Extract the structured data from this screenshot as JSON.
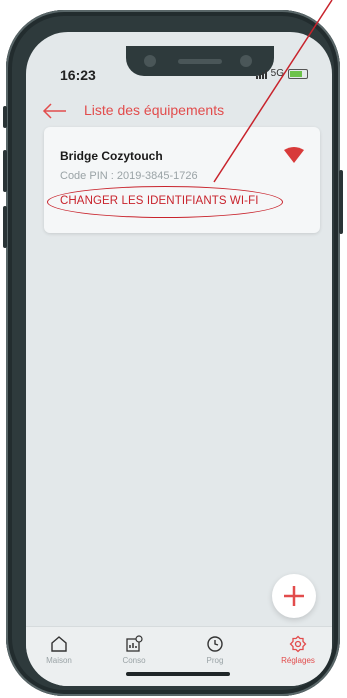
{
  "status_bar": {
    "time": "16:23",
    "network": "5G"
  },
  "header": {
    "title": "Liste des équipements"
  },
  "device_card": {
    "name": "Bridge Cozytouch",
    "pin": "Code PIN : 2019-3845-1726",
    "action_label": "CHANGER LES IDENTIFIANTS WI-FI"
  },
  "tabs": [
    {
      "label": "Maison",
      "icon": "home-icon",
      "active": false
    },
    {
      "label": "Conso",
      "icon": "consumption-icon",
      "active": false
    },
    {
      "label": "Prog",
      "icon": "clock-icon",
      "active": false
    },
    {
      "label": "Réglages",
      "icon": "gear-icon",
      "active": true
    }
  ],
  "colors": {
    "accent": "#e24c4c",
    "annotation": "#c8232c",
    "phone_frame": "#2e3a3c",
    "screen_bg": "#e3e8ea"
  }
}
